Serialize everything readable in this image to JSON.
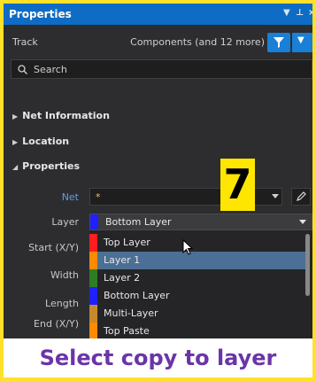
{
  "panel": {
    "title": "Properties",
    "title_icons": [
      "▼",
      "📌",
      "✕"
    ]
  },
  "filter": {
    "object_kind": "Track",
    "components_label": "Components (and 12 more)"
  },
  "search": {
    "placeholder": "Search"
  },
  "sections": {
    "net_information": "Net Information",
    "location": "Location",
    "properties": "Properties"
  },
  "props": {
    "net_label": "Net",
    "net_value": "*",
    "layer_label": "Layer",
    "layer_value": "Bottom Layer",
    "start_label": "Start (X/Y)",
    "width_label": "Width",
    "length_label": "Length",
    "end_label": "End (X/Y)"
  },
  "layer_options": [
    {
      "label": "Top Layer",
      "color": "#ff1d1d"
    },
    {
      "label": "Layer 1",
      "color": "#ff8a00",
      "selected": true
    },
    {
      "label": "Layer 2",
      "color": "#2e7d23"
    },
    {
      "label": "Bottom Layer",
      "color": "#1f1fff"
    },
    {
      "label": "Multi-Layer",
      "color": "#c68a2a"
    },
    {
      "label": "Top Paste",
      "color": "#ff8a00"
    }
  ],
  "step_number": "7",
  "caption": "Select copy to layer",
  "colors": {
    "title_bar": "#0f6cc4",
    "frame": "#ffe12a",
    "caption": "#6a35a8",
    "badge": "#ffe600"
  }
}
